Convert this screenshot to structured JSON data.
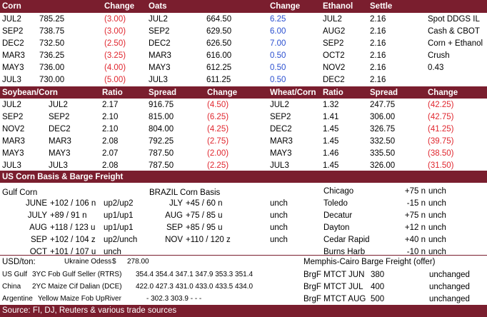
{
  "grains": {
    "headers": {
      "corn": "Corn",
      "change": "Change",
      "oats": "Oats",
      "change2": "Change",
      "ethanol": "Ethanol",
      "settle": "Settle"
    },
    "rows": [
      {
        "corn_m": "JUL2",
        "corn_p": "785.25",
        "corn_c": "(3.00)",
        "oats_m": "JUL2",
        "oats_p": "664.50",
        "oats_c": "6.25",
        "eth_m": "JUL2",
        "eth_s": "2.16",
        "note": "Spot DDGS IL"
      },
      {
        "corn_m": "SEP2",
        "corn_p": "738.75",
        "corn_c": "(3.00)",
        "oats_m": "SEP2",
        "oats_p": "629.50",
        "oats_c": "6.00",
        "eth_m": "AUG2",
        "eth_s": "2.16",
        "note": "Cash & CBOT"
      },
      {
        "corn_m": "DEC2",
        "corn_p": "732.50",
        "corn_c": "(2.50)",
        "oats_m": "DEC2",
        "oats_p": "626.50",
        "oats_c": "7.00",
        "eth_m": "SEP2",
        "eth_s": "2.16",
        "note": "Corn + Ethanol"
      },
      {
        "corn_m": "MAR3",
        "corn_p": "736.25",
        "corn_c": "(3.25)",
        "oats_m": "MAR3",
        "oats_p": "616.00",
        "oats_c": "0.50",
        "eth_m": "OCT2",
        "eth_s": "2.16",
        "note": "Crush"
      },
      {
        "corn_m": "MAY3",
        "corn_p": "736.00",
        "corn_c": "(4.00)",
        "oats_m": "MAY3",
        "oats_p": "612.25",
        "oats_c": "0.50",
        "eth_m": "NOV2",
        "eth_s": "2.16",
        "note": "0.43"
      },
      {
        "corn_m": "JUL3",
        "corn_p": "730.00",
        "corn_c": "(5.00)",
        "oats_m": "JUL3",
        "oats_p": "611.25",
        "oats_c": "0.50",
        "eth_m": "DEC2",
        "eth_s": "2.16",
        "note": ""
      }
    ]
  },
  "spreads": {
    "headers": {
      "soycorn": "Soybean/Corn",
      "ratio": "Ratio",
      "spread": "Spread",
      "change": "Change",
      "wheatcorn": "Wheat/Corn",
      "ratio2": "Ratio",
      "spread2": "Spread",
      "change2": "Change"
    },
    "rows": [
      {
        "s": "JUL2",
        "c": "JUL2",
        "r": "2.17",
        "sp": "916.75",
        "ch": "(4.50)",
        "w": "JUL2",
        "wr": "1.32",
        "wsp": "247.75",
        "wch": "(42.25)"
      },
      {
        "s": "SEP2",
        "c": "SEP2",
        "r": "2.10",
        "sp": "815.00",
        "ch": "(6.25)",
        "w": "SEP2",
        "wr": "1.41",
        "wsp": "306.00",
        "wch": "(42.75)"
      },
      {
        "s": "NOV2",
        "c": "DEC2",
        "r": "2.10",
        "sp": "804.00",
        "ch": "(4.25)",
        "w": "DEC2",
        "wr": "1.45",
        "wsp": "326.75",
        "wch": "(41.25)"
      },
      {
        "s": "MAR3",
        "c": "MAR3",
        "r": "2.08",
        "sp": "792.25",
        "ch": "(2.75)",
        "w": "MAR3",
        "wr": "1.45",
        "wsp": "332.50",
        "wch": "(39.75)"
      },
      {
        "s": "MAY3",
        "c": "MAY3",
        "r": "2.07",
        "sp": "787.50",
        "ch": "(2.00)",
        "w": "MAY3",
        "wr": "1.46",
        "wsp": "335.50",
        "wch": "(38.50)"
      },
      {
        "s": "JUL3",
        "c": "JUL3",
        "r": "2.08",
        "sp": "787.50",
        "ch": "(2.25)",
        "w": "JUL3",
        "wr": "1.45",
        "wsp": "326.00",
        "wch": "(31.50)"
      }
    ]
  },
  "basis": {
    "title": "US Corn Basis & Barge Freight",
    "gulf_label": "Gulf Corn",
    "brazil_label": "BRAZIL Corn Basis",
    "gulf": [
      {
        "m": "JUNE",
        "v": "+102 / 106 n",
        "t": "up2/up2"
      },
      {
        "m": "JULY",
        "v": "+89 / 91 n",
        "t": "up1/up1"
      },
      {
        "m": "AUG",
        "v": "+118 / 123 u",
        "t": "up1/up1"
      },
      {
        "m": "SEP",
        "v": "+102 / 104 z",
        "t": "up2/unch"
      },
      {
        "m": "OCT",
        "v": "+101 / 107 u",
        "t": "unch"
      }
    ],
    "brazil": [
      {
        "m": "JLY",
        "v": "+45 / 60 n",
        "t": "unch"
      },
      {
        "m": "AUG",
        "v": "+75 / 85 u",
        "t": "unch"
      },
      {
        "m": "SEP",
        "v": "+85 / 95 u",
        "t": "unch"
      },
      {
        "m": "NOV",
        "v": "+110 / 120 z",
        "t": "unch"
      }
    ],
    "interior": [
      {
        "loc": "Chicago",
        "v": "+75 n",
        "t": "unch"
      },
      {
        "loc": "Toledo",
        "v": "-15 n",
        "t": "unch"
      },
      {
        "loc": "Decatur",
        "v": "+75 n",
        "t": "unch"
      },
      {
        "loc": "Dayton",
        "v": "+12 n",
        "t": "unch"
      },
      {
        "loc": "Cedar Rapid",
        "v": "+40 n",
        "t": "unch"
      },
      {
        "loc": "Burns Harb",
        "v": "-10 n",
        "t": "unch"
      }
    ]
  },
  "fob": {
    "usd_label": "USD/ton:",
    "ukraine_label": "Ukraine Odess",
    "ukraine_sym": "$",
    "ukraine_val": "278.00",
    "rows": [
      {
        "origin": "US Gulf",
        "desc": "3YC Fob Gulf Seller (RTRS)",
        "vals": "354.4  354.4  347.1  347.9  353.3  351.4"
      },
      {
        "origin": "China",
        "desc": "2YC Maize Cif Dalian (DCE)",
        "vals": "422.0  427.3  431.0  433.0  433.5  434.0"
      },
      {
        "origin": "Argentine",
        "desc": "Yellow Maize Fob UpRiver",
        "vals": "-   302.3  303.9    -     -     -"
      }
    ]
  },
  "barge": {
    "title": "Memphis-Cairo Barge Freight (offer)",
    "rows": [
      {
        "label": "BrgF MTCT JUN",
        "v": "380",
        "t": "unchanged"
      },
      {
        "label": "BrgF MTCT JUL",
        "v": "400",
        "t": "unchanged"
      },
      {
        "label": "BrgF MTCT AUG",
        "v": "500",
        "t": "unchanged"
      }
    ]
  },
  "footer": "Source: FI, DJ, Reuters & various trade sources",
  "colors": {
    "header_bg": "#7a1e2e",
    "negative": "#e0262e",
    "positive": "#2a4fd0"
  }
}
